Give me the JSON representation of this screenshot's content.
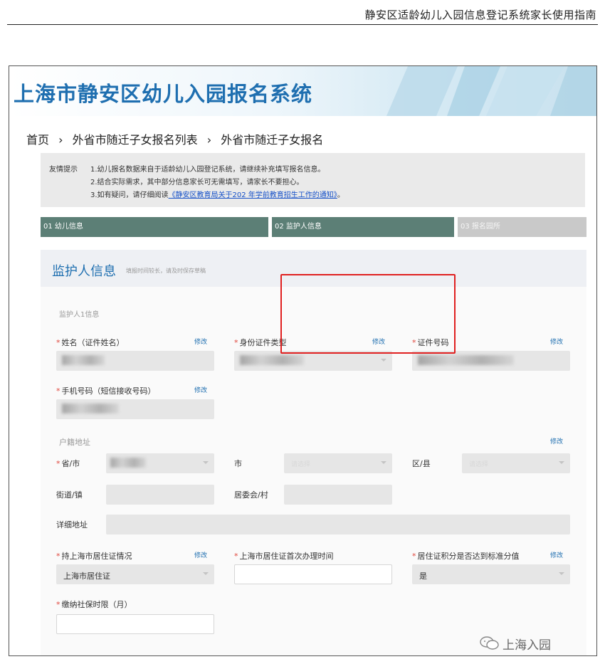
{
  "doc": {
    "header_title": "静安区适龄幼儿入园信息登记系统家长使用指南"
  },
  "app": {
    "system_title": "上海市静安区幼儿入园报名系统",
    "breadcrumb": [
      "首页",
      "›",
      "外省市随迁子女报名列表",
      "›",
      "外省市随迁子女报名"
    ]
  },
  "tips": {
    "label": "友情提示",
    "line1": "1.幼儿报名数据来自于适龄幼儿入园登记系统，请继续补充填写报名信息。",
    "line2": "2.结合实际需求，其中部分信息家长可无需填写，请家长不要担心。",
    "line3_prefix": "3.如有疑问，请仔细阅读",
    "line3_link": "《静安区教育局关于202 年学前教育招生工作的通知》",
    "line3_suffix": "。"
  },
  "steps": [
    {
      "label": "01 幼儿信息",
      "state": "active"
    },
    {
      "label": "02 监护人信息",
      "state": "active"
    },
    {
      "label": "03 报名园所",
      "state": "inactive"
    }
  ],
  "card": {
    "title": "监护人信息",
    "hint": "填报时间较长，请及时保存草稿",
    "section_guardian1": "监护人1信息",
    "section_address": "户籍地址"
  },
  "fields": {
    "name_label": "姓名（证件姓名）",
    "id_type_label": "身份证件类型",
    "id_number_label": "证件号码",
    "phone_label": "手机号码（短信接收号码）",
    "province_label": "省/市",
    "city_label": "市",
    "district_label": "区/县",
    "street_label": "街道/镇",
    "committee_label": "居委会/村",
    "detail_address_label": "详细地址",
    "residence_status_label": "持上海市居住证情况",
    "residence_status_value": "上海市居住证",
    "residence_first_time_label": "上海市居住证首次办理时间",
    "points_label": "居住证积分是否达到标准分值",
    "points_value": "是",
    "social_security_label": "缴纳社保时限（月）",
    "city_placeholder": "请选择",
    "district_placeholder": "请选择",
    "edit_label": "修改"
  },
  "watermark": {
    "text": "上海入园"
  },
  "colors": {
    "brand_blue": "#1f6fb0",
    "step_active": "#5c7f76",
    "step_inactive": "#c9c9c9",
    "required_mark": "#e0463c",
    "highlight_red": "#e02020",
    "tip_link": "#1550c8"
  }
}
